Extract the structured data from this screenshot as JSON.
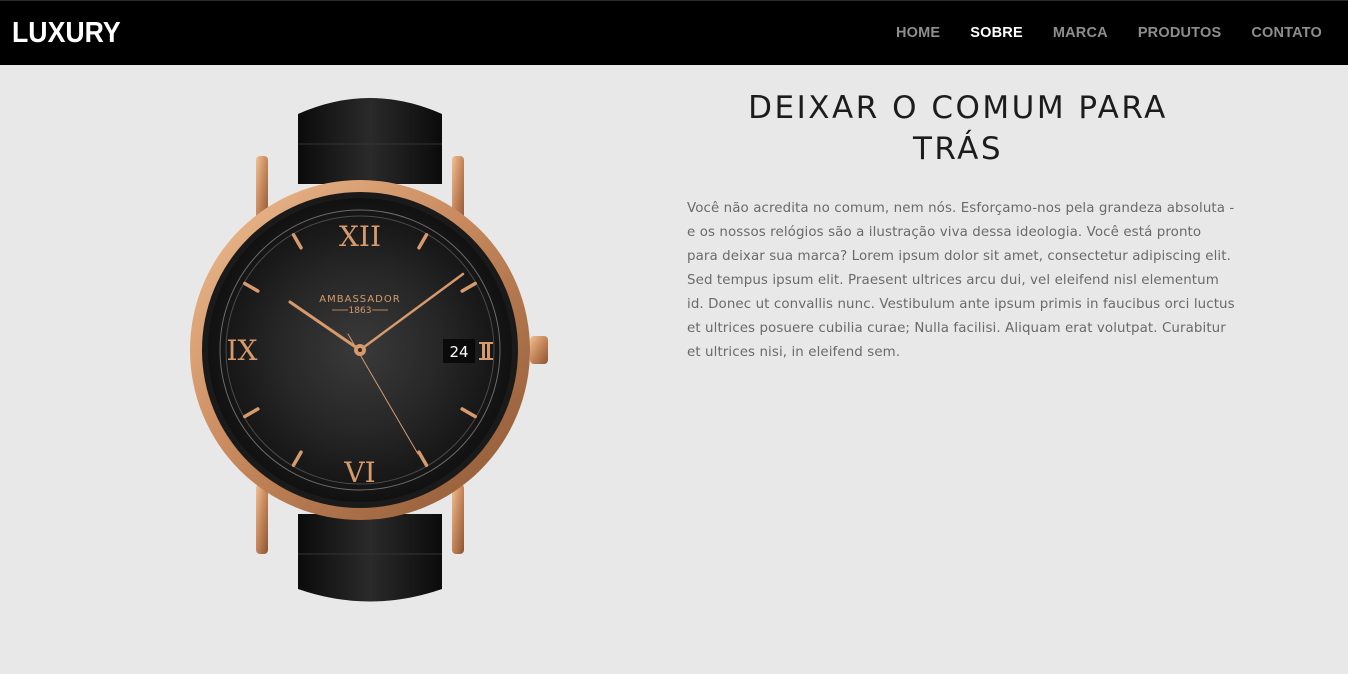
{
  "header": {
    "logo": "LUXURY",
    "nav": [
      {
        "label": "HOME",
        "active": false
      },
      {
        "label": "SOBRE",
        "active": true
      },
      {
        "label": "MARCA",
        "active": false
      },
      {
        "label": "PRODUTOS",
        "active": false
      },
      {
        "label": "CONTATO",
        "active": false
      }
    ]
  },
  "hero": {
    "image": {
      "brand": "AMBASSADOR",
      "year": "1863",
      "date": "24",
      "numerals": [
        "XII",
        "IX",
        "VI",
        "III"
      ]
    },
    "heading_line1": "DEIXAR O COMUM PARA",
    "heading_line2": "TRÁS",
    "paragraph1": "Você não acredita no comum, nem nós. Esforçamo-nos pela grandeza absoluta - e os nossos relógios são a ilustração viva dessa ideologia. Você está pronto para deixar sua marca? Lorem ipsum dolor sit amet, consectetur adipiscing elit.",
    "paragraph2": "Sed tempus ipsum elit. Praesent ultrices arcu dui, vel eleifend nisl elementum id. Donec ut convallis nunc. Vestibulum ante ipsum primis in faucibus orci luctus et ultrices posuere cubilia curae; Nulla facilisi. Aliquam erat volutpat. Curabitur et ultrices nisi, in eleifend sem."
  },
  "colors": {
    "nav_background": "#000000",
    "page_background": "#e8e8e8",
    "nav_active": "#ffffff",
    "nav_inactive": "#8e8e8e",
    "rose_gold": "#d79a6c"
  }
}
